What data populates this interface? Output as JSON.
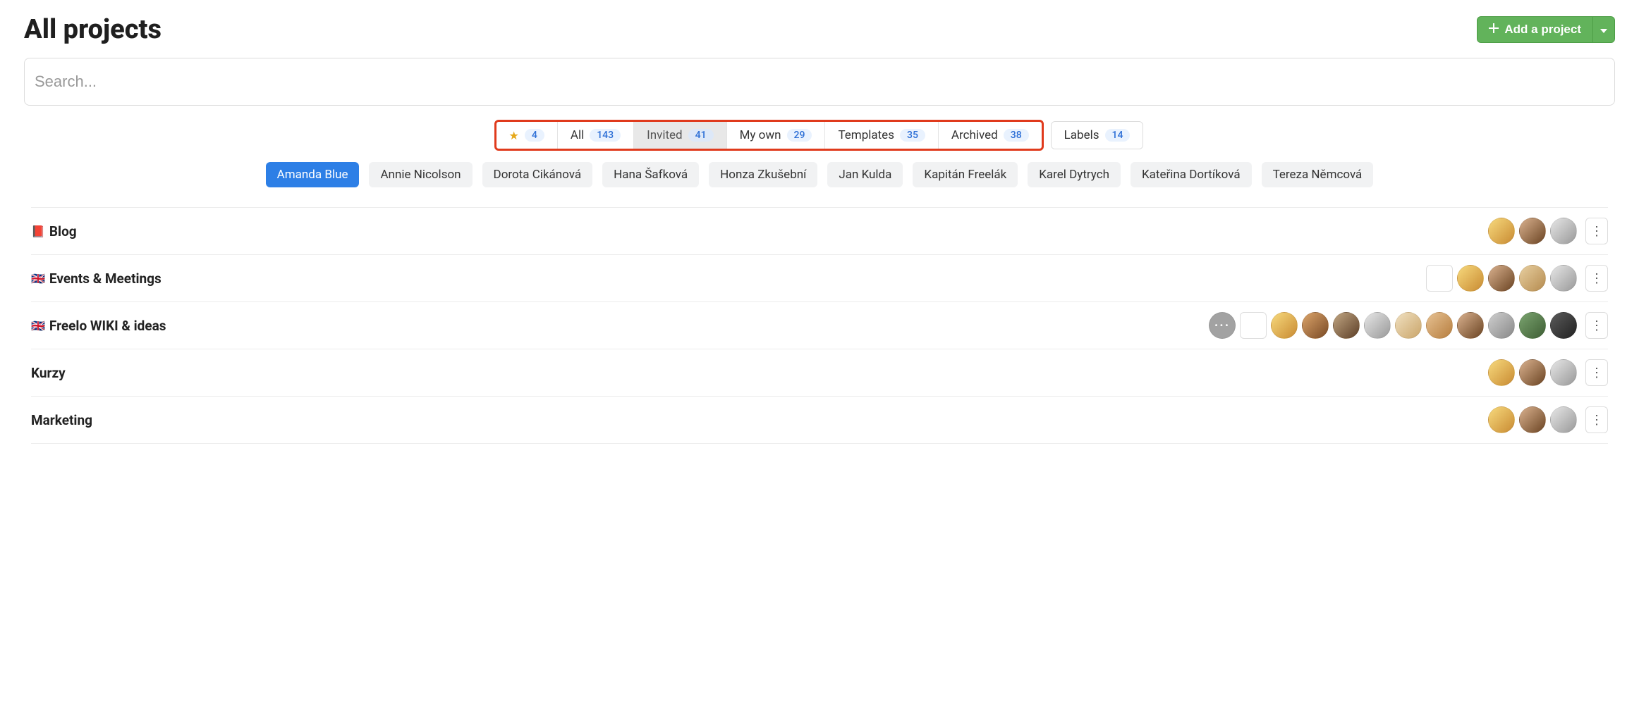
{
  "header": {
    "title": "All projects",
    "add_button_label": "Add a project"
  },
  "search": {
    "placeholder": "Search..."
  },
  "tabs": {
    "starred_count": "4",
    "all_label": "All",
    "all_count": "143",
    "invited_label": "Invited",
    "invited_count": "41",
    "myown_label": "My own",
    "myown_count": "29",
    "templates_label": "Templates",
    "templates_count": "35",
    "archived_label": "Archived",
    "archived_count": "38",
    "labels_label": "Labels",
    "labels_count": "14"
  },
  "people": [
    {
      "name": "Amanda Blue",
      "selected": true
    },
    {
      "name": "Annie Nicolson",
      "selected": false
    },
    {
      "name": "Dorota Cikánová",
      "selected": false
    },
    {
      "name": "Hana Šafková",
      "selected": false
    },
    {
      "name": "Honza Zkušební",
      "selected": false
    },
    {
      "name": "Jan Kulda",
      "selected": false
    },
    {
      "name": "Kapitán Freelák",
      "selected": false
    },
    {
      "name": "Karel Dytrych",
      "selected": false
    },
    {
      "name": "Kateřina Dortíková",
      "selected": false
    },
    {
      "name": "Tereza Němcová",
      "selected": false
    }
  ],
  "projects": [
    {
      "icon": "📕",
      "name": "Blog",
      "more_avatar": false,
      "square_avatar": false,
      "avatars": [
        "linear-gradient(135deg,#f7d97d,#c98b32)",
        "linear-gradient(135deg,#d9b18e,#6b4423)",
        "linear-gradient(135deg,#e6e6e6,#999)"
      ]
    },
    {
      "icon": "🇬🇧",
      "name": "Events & Meetings",
      "more_avatar": false,
      "square_avatar": true,
      "avatars": [
        "linear-gradient(135deg,#f7d97d,#c98b32)",
        "linear-gradient(135deg,#d9b18e,#6b4423)",
        "linear-gradient(135deg,#e8cfa0,#b58b4f)",
        "linear-gradient(135deg,#e6e6e6,#999)"
      ]
    },
    {
      "icon": "🇬🇧",
      "name": "Freelo WIKI & ideas",
      "more_avatar": true,
      "square_avatar": true,
      "avatars": [
        "linear-gradient(135deg,#f7d97d,#c98b32)",
        "linear-gradient(135deg,#dba46b,#7a4a24)",
        "linear-gradient(135deg,#c0a582,#5e4028)",
        "linear-gradient(135deg,#e6e6e6,#999)",
        "linear-gradient(135deg,#f0e0c0,#caa56a)",
        "linear-gradient(135deg,#e6c192,#b77e3f)",
        "linear-gradient(135deg,#d9b18e,#6b4423)",
        "linear-gradient(135deg,#cfcfcf,#888)",
        "linear-gradient(135deg,#7aa36f,#3e5e34)",
        "linear-gradient(135deg,#5a5a5a,#222)"
      ]
    },
    {
      "icon": "",
      "name": "Kurzy",
      "more_avatar": false,
      "square_avatar": false,
      "avatars": [
        "linear-gradient(135deg,#f7d97d,#c98b32)",
        "linear-gradient(135deg,#d9b18e,#6b4423)",
        "linear-gradient(135deg,#e6e6e6,#999)"
      ]
    },
    {
      "icon": "",
      "name": "Marketing",
      "more_avatar": false,
      "square_avatar": false,
      "avatars": [
        "linear-gradient(135deg,#f7d97d,#c98b32)",
        "linear-gradient(135deg,#d9b18e,#6b4423)",
        "linear-gradient(135deg,#e6e6e6,#999)"
      ]
    }
  ]
}
